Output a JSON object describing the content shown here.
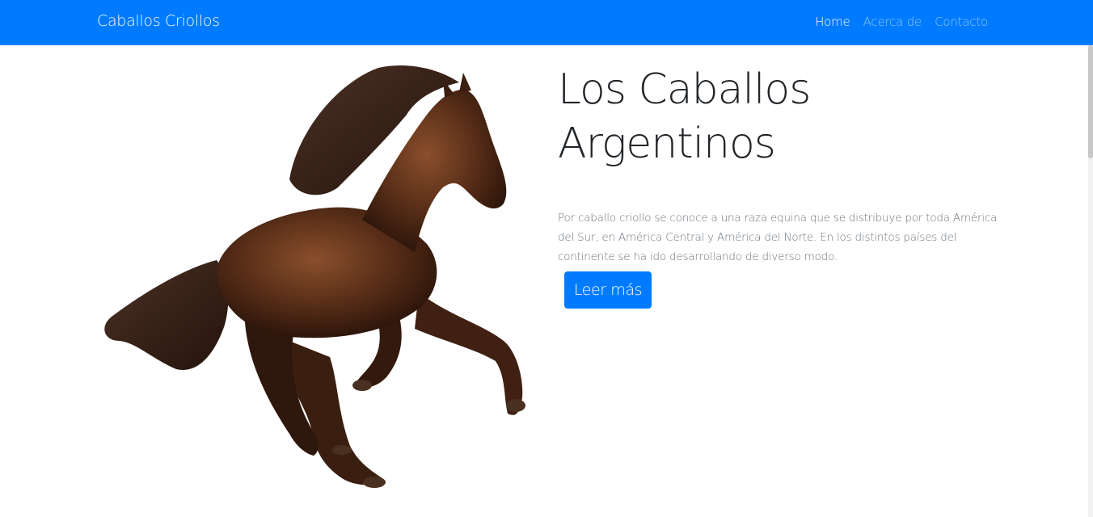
{
  "navbar": {
    "brand": "Caballos Criollos",
    "links": [
      {
        "label": "Home",
        "active": true
      },
      {
        "label": "Acerca de",
        "active": false
      },
      {
        "label": "Contacto",
        "active": false
      }
    ],
    "background": "#007bff"
  },
  "hero": {
    "title_line1": "Los Caballos",
    "title_line2": "Argentinos",
    "text": "Por caballo criollo se conoce a una raza equina que se distribuye por toda América del Sur, en América Central y América del Norte. En los distintos países del continente se ha ido desarrollando de diverso modo.",
    "button_label": "Leer más",
    "image": "galloping-brown-horse"
  }
}
